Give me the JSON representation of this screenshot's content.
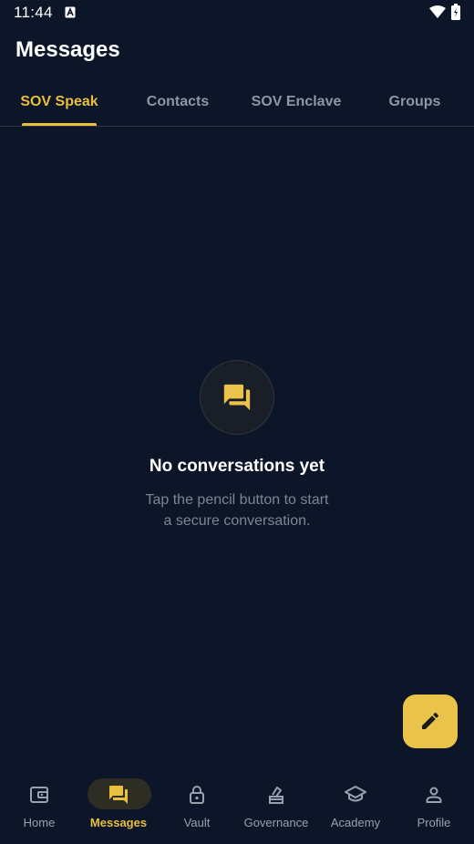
{
  "status_bar": {
    "time": "11:44"
  },
  "header": {
    "title": "Messages"
  },
  "tabs": [
    {
      "label": "SOV Speak",
      "active": true
    },
    {
      "label": "Contacts",
      "active": false
    },
    {
      "label": "SOV Enclave",
      "active": false
    },
    {
      "label": "Groups",
      "active": false
    }
  ],
  "empty_state": {
    "icon": "forum-icon",
    "title": "No conversations yet",
    "subtitle_line1": "Tap the pencil button to start",
    "subtitle_line2": "a secure conversation."
  },
  "fab": {
    "icon": "pencil-icon"
  },
  "bottom_nav": [
    {
      "label": "Home",
      "icon": "wallet-icon",
      "active": false
    },
    {
      "label": "Messages",
      "icon": "forum-icon",
      "active": true
    },
    {
      "label": "Vault",
      "icon": "lock-icon",
      "active": false
    },
    {
      "label": "Governance",
      "icon": "vote-icon",
      "active": false
    },
    {
      "label": "Academy",
      "icon": "school-icon",
      "active": false
    },
    {
      "label": "Profile",
      "icon": "person-icon",
      "active": false
    }
  ],
  "colors": {
    "background": "#0c1628",
    "accent": "#e9bf3e",
    "inactive_text": "#8f96a3"
  }
}
